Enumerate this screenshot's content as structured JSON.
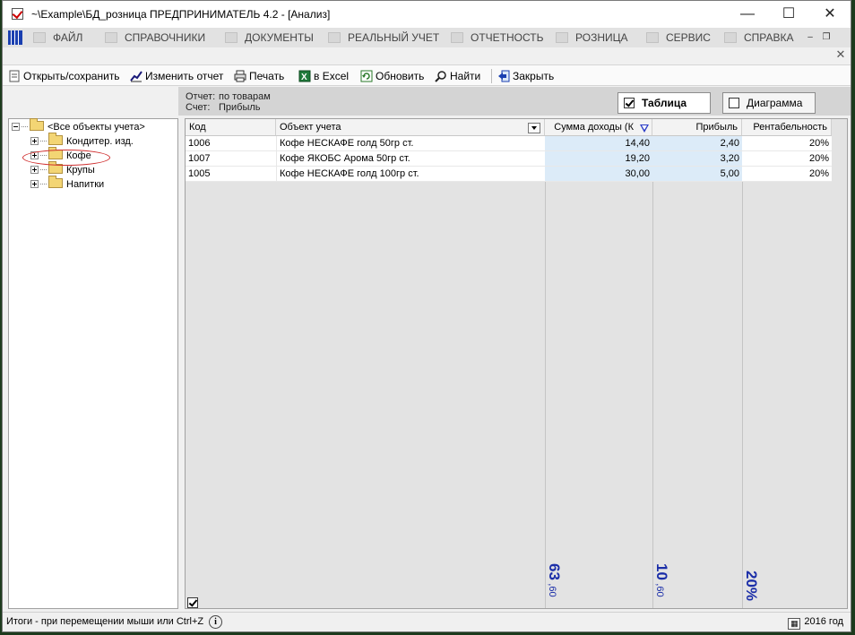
{
  "window": {
    "title": "~\\Example\\БД_розница  ПРЕДПРИНИМАТЕЛЬ 4.2 - [Анализ]",
    "controls": {
      "minimize": "—",
      "maximize": "☐",
      "close": "✕"
    }
  },
  "menu": {
    "items": [
      "ФАЙЛ",
      "СПРАВОЧНИКИ",
      "ДОКУМЕНТЫ",
      "РЕАЛЬНЫЙ УЧЕТ",
      "ОТЧЕТНОСТЬ",
      "РОЗНИЦА",
      "СЕРВИС",
      "СПРАВКА"
    ],
    "mdi_minimize": "–",
    "mdi_restore": "❐",
    "doc_close": "✕"
  },
  "toolbar": {
    "open_save": "Открыть/сохранить",
    "edit_report": "Изменить отчет",
    "print": "Печать",
    "excel": "в Excel",
    "refresh": "Обновить",
    "find": "Найти",
    "close": "Закрыть"
  },
  "report": {
    "report_label": "Отчет:",
    "report_value": "по товарам",
    "account_label": "Счет:",
    "account_value": "Прибыль",
    "view_table": "Таблица",
    "view_chart": "Диаграмма",
    "view_table_checked": true,
    "view_chart_checked": false
  },
  "tree": {
    "root": "<Все объекты учета>",
    "children": [
      "Кондитер. изд.",
      "Кофе",
      "Крупы",
      "Напитки"
    ],
    "highlighted": "Кофе"
  },
  "grid": {
    "headers": {
      "code": "Код",
      "object": "Объект учета",
      "income": "Сумма доходы (К",
      "profit": "Прибыль",
      "margin": "Рентабельность"
    },
    "rows": [
      {
        "code": "1006",
        "object": "Кофе НЕСКАФЕ голд 50гр ст.",
        "income": "14,40",
        "profit": "2,40",
        "margin": "20%"
      },
      {
        "code": "1007",
        "object": "Кофе ЯКОБС Арома 50гр ст.",
        "income": "19,20",
        "profit": "3,20",
        "margin": "20%"
      },
      {
        "code": "1005",
        "object": "Кофе НЕСКАФЕ голд 100гр ст.",
        "income": "30,00",
        "profit": "5,00",
        "margin": "20%"
      }
    ],
    "totals": {
      "income_int": "63",
      "income_frac": ",60",
      "profit_int": "10",
      "profit_frac": ",60",
      "margin": "20%"
    },
    "totals_checked": true
  },
  "status": {
    "hint": "Итоги - при перемещении мыши или Ctrl+Z",
    "info_icon": "i",
    "year": "2016 год"
  },
  "colors": {
    "accent_blue": "#1b2ea8",
    "highlight_cell": "#dcebf8",
    "ellipse": "#d03030"
  }
}
